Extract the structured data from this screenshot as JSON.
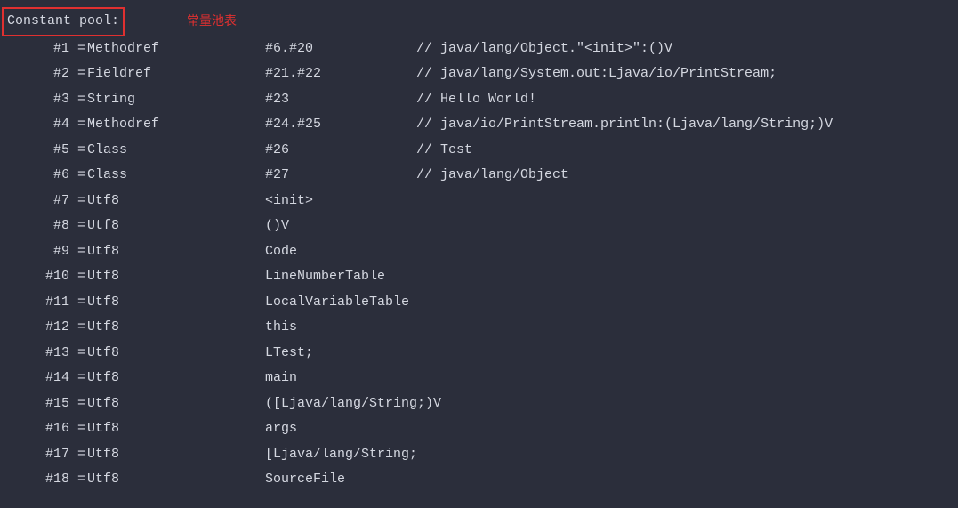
{
  "header": {
    "title": "Constant pool:",
    "annotation": "常量池表"
  },
  "entries": [
    {
      "index": "#1",
      "eq": "=",
      "type": "Methodref",
      "ref": "#6.#20",
      "comment": "// java/lang/Object.\"<init>\":()V"
    },
    {
      "index": "#2",
      "eq": "=",
      "type": "Fieldref",
      "ref": "#21.#22",
      "comment": "// java/lang/System.out:Ljava/io/PrintStream;"
    },
    {
      "index": "#3",
      "eq": "=",
      "type": "String",
      "ref": "#23",
      "comment": "// Hello World!"
    },
    {
      "index": "#4",
      "eq": "=",
      "type": "Methodref",
      "ref": "#24.#25",
      "comment": "// java/io/PrintStream.println:(Ljava/lang/String;)V"
    },
    {
      "index": "#5",
      "eq": "=",
      "type": "Class",
      "ref": "#26",
      "comment": "// Test"
    },
    {
      "index": "#6",
      "eq": "=",
      "type": "Class",
      "ref": "#27",
      "comment": "// java/lang/Object"
    },
    {
      "index": "#7",
      "eq": "=",
      "type": "Utf8",
      "ref": "<init>",
      "comment": ""
    },
    {
      "index": "#8",
      "eq": "=",
      "type": "Utf8",
      "ref": "()V",
      "comment": ""
    },
    {
      "index": "#9",
      "eq": "=",
      "type": "Utf8",
      "ref": "Code",
      "comment": ""
    },
    {
      "index": "#10",
      "eq": "=",
      "type": "Utf8",
      "ref": "LineNumberTable",
      "comment": ""
    },
    {
      "index": "#11",
      "eq": "=",
      "type": "Utf8",
      "ref": "LocalVariableTable",
      "comment": ""
    },
    {
      "index": "#12",
      "eq": "=",
      "type": "Utf8",
      "ref": "this",
      "comment": ""
    },
    {
      "index": "#13",
      "eq": "=",
      "type": "Utf8",
      "ref": "LTest;",
      "comment": ""
    },
    {
      "index": "#14",
      "eq": "=",
      "type": "Utf8",
      "ref": "main",
      "comment": ""
    },
    {
      "index": "#15",
      "eq": "=",
      "type": "Utf8",
      "ref": "([Ljava/lang/String;)V",
      "comment": ""
    },
    {
      "index": "#16",
      "eq": "=",
      "type": "Utf8",
      "ref": "args",
      "comment": ""
    },
    {
      "index": "#17",
      "eq": "=",
      "type": "Utf8",
      "ref": "[Ljava/lang/String;",
      "comment": ""
    },
    {
      "index": "#18",
      "eq": "=",
      "type": "Utf8",
      "ref": "SourceFile",
      "comment": ""
    }
  ]
}
